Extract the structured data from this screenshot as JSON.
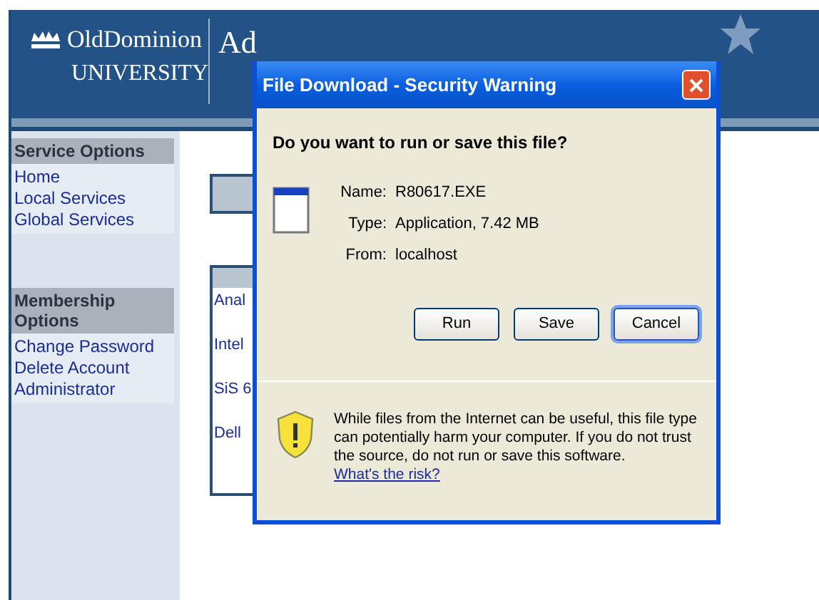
{
  "header": {
    "logo_top": "OldDominion",
    "logo_bottom": "UNIVERSITY",
    "title": "Ad"
  },
  "sidebar": {
    "sections": [
      {
        "title": "Service Options",
        "items": [
          "Home",
          "Local Services",
          "Global Services"
        ]
      },
      {
        "title": "Membership Options",
        "items": [
          "Change Password",
          "Delete Account",
          "Administrator"
        ]
      }
    ]
  },
  "content": {
    "rows": [
      "Anal",
      "Intel",
      "SiS 6",
      "Dell"
    ]
  },
  "dialog": {
    "title": "File Download - Security Warning",
    "question": "Do you want to run or save this file?",
    "fields": [
      {
        "label": "Name:",
        "value": "R80617.EXE"
      },
      {
        "label": "Type:",
        "value": "Application, 7.42 MB"
      },
      {
        "label": "From:",
        "value": "localhost"
      }
    ],
    "buttons": [
      {
        "label": "Run",
        "selected": false
      },
      {
        "label": "Save",
        "selected": false
      },
      {
        "label": "Cancel",
        "selected": true
      }
    ],
    "warning": "While files from the Internet can be useful, this file type can potentially harm your computer. If you do not trust the source, do not run or save this software.",
    "link": "What's the risk?"
  }
}
